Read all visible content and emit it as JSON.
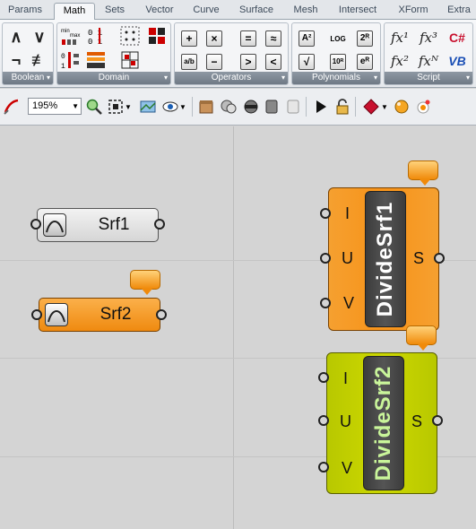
{
  "tabs": [
    "Params",
    "Math",
    "Sets",
    "Vector",
    "Curve",
    "Surface",
    "Mesh",
    "Intersect",
    "XForm",
    "Extra"
  ],
  "active_tab": "Math",
  "ribbon": {
    "panels": {
      "boolean": "Boolean",
      "domain": "Domain",
      "operators": "Operators",
      "polynomials": "Polynomials",
      "script": "Script"
    },
    "boolean_icons": [
      "and-icon",
      "or-icon",
      "not-icon",
      "not-equal-icon"
    ],
    "domain_icons": [
      "construct-domain-icon",
      "deconstruct-domain-icon",
      "domain-grid-icon",
      "domain-squares-icon",
      "bounds-icon",
      "remap-icon",
      "divide-domain-icon"
    ],
    "operators": {
      "plus": "+",
      "multiply": "×",
      "equals": "=",
      "similar": "≈",
      "division": "a/b",
      "minus": "−",
      "greater": ">",
      "less": "<"
    },
    "polynomials": {
      "square": "A²",
      "log": "LOG",
      "power": "2ᴿ",
      "sqrt": "√",
      "ten_power": "10ᴿ",
      "exp": "eᴿ"
    },
    "script": {
      "f1": "fx¹",
      "f3": "fx³",
      "f2": "fx²",
      "fn": "fxᴺ",
      "csharp": "C#",
      "vb": "VB"
    }
  },
  "toolbar": {
    "zoom": "195%"
  },
  "canvas": {
    "params": [
      {
        "name": "Srf1",
        "color": "#e6e6e6"
      },
      {
        "name": "Srf2",
        "color": "#f7951d"
      }
    ],
    "components": [
      {
        "name": "DivideSrf1",
        "color": "#f7951d",
        "inputs": [
          "I",
          "U",
          "V"
        ],
        "outputs": [
          "S"
        ],
        "title_color": "#ffffff"
      },
      {
        "name": "DivideSrf2",
        "color": "#c5d400",
        "inputs": [
          "I",
          "U",
          "V"
        ],
        "outputs": [
          "S"
        ],
        "title_color": "#c9f59a"
      }
    ]
  }
}
